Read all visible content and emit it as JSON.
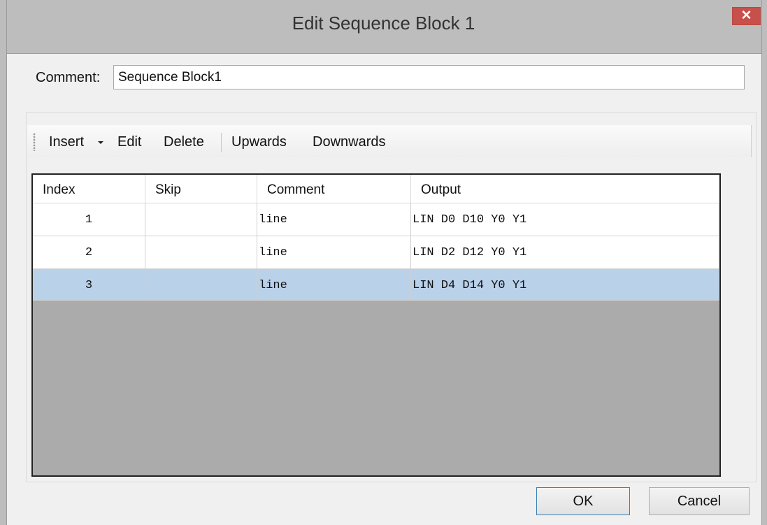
{
  "window": {
    "title": "Edit Sequence Block 1",
    "close_glyph": "✕"
  },
  "comment": {
    "label": "Comment:",
    "value": "Sequence Block1"
  },
  "toolbar": {
    "insert": "Insert",
    "edit": "Edit",
    "delete": "Delete",
    "upwards": "Upwards",
    "downwards": "Downwards"
  },
  "grid": {
    "columns": [
      "Index",
      "Skip",
      "Comment",
      "Output"
    ],
    "rows": [
      {
        "index": "1",
        "skip": "",
        "comment": "line",
        "output": "LIN D0 D10 Y0 Y1",
        "selected": false
      },
      {
        "index": "2",
        "skip": "",
        "comment": "line",
        "output": "LIN D2 D12 Y0 Y1",
        "selected": false
      },
      {
        "index": "3",
        "skip": "",
        "comment": "line",
        "output": "LIN D4 D14 Y0 Y1",
        "selected": true
      }
    ]
  },
  "buttons": {
    "ok": "OK",
    "cancel": "Cancel"
  },
  "colors": {
    "selection": "#bad1ea",
    "close": "#c7504a",
    "titlebar": "#bdbdbd"
  }
}
